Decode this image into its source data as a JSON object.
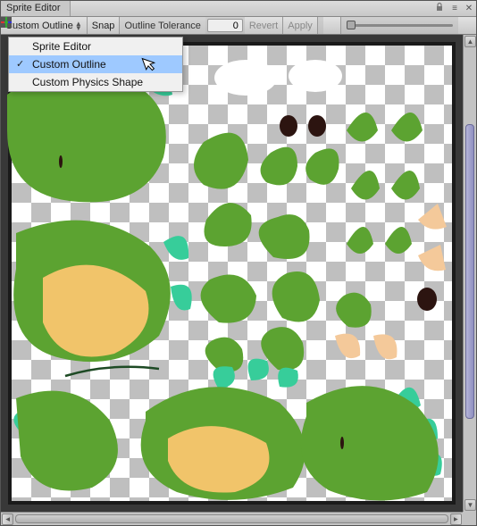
{
  "title": "Sprite Editor",
  "toolbar": {
    "mode_dropdown": "Custom Outline",
    "snap": "Snap",
    "tolerance_label": "Outline Tolerance",
    "tolerance_value": "0",
    "revert": "Revert",
    "apply": "Apply"
  },
  "dropdown": {
    "items": [
      {
        "label": "Sprite Editor",
        "checked": false,
        "selected": false
      },
      {
        "label": "Custom Outline",
        "checked": true,
        "selected": true
      },
      {
        "label": "Custom Physics Shape",
        "checked": false,
        "selected": false
      }
    ]
  },
  "icons": {
    "window_menu": "≡",
    "triup": "▲",
    "tridown": "▼",
    "close": "✕",
    "lock": "🔒"
  }
}
